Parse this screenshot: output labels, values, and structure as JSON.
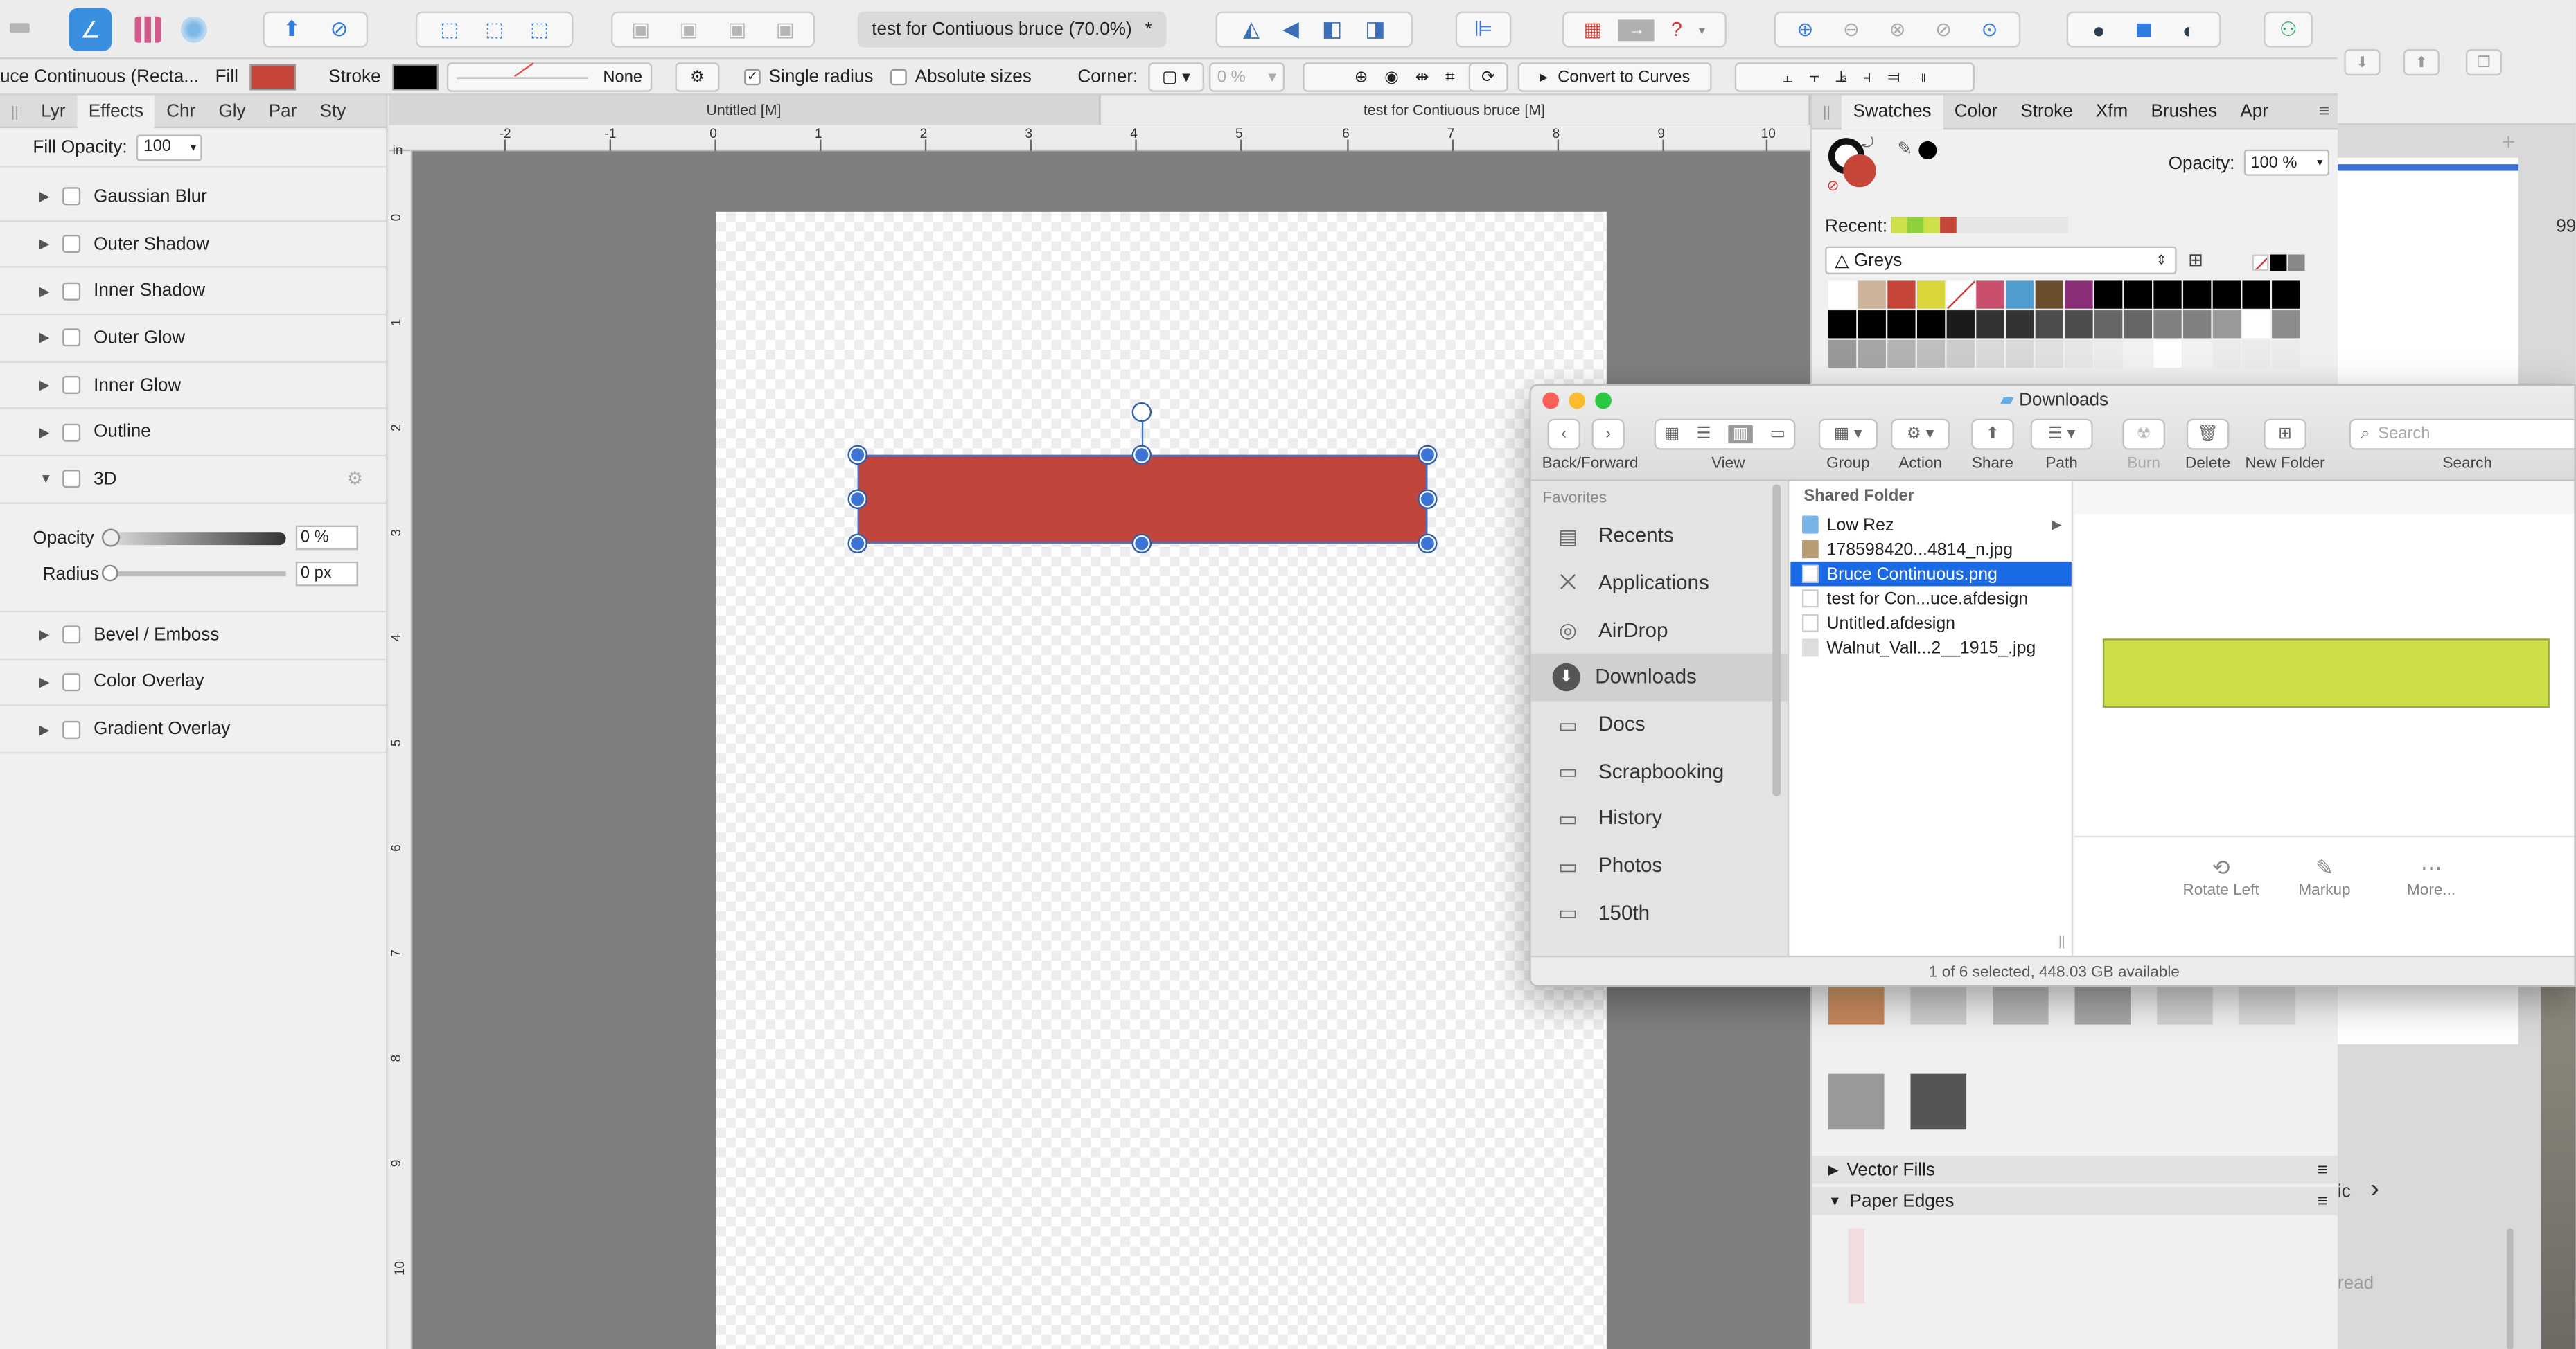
{
  "toolbar": {
    "doc_title": "test for Contiuous bruce (70.0%)",
    "modified_mark": "*",
    "tool_icons": [
      "persona-designer-icon",
      "persona-pixel-icon",
      "persona-export-icon",
      "share-icon",
      "forbidden-icon"
    ]
  },
  "contextbar": {
    "layer_name": "uce Continuous (Recta...",
    "fill_label": "Fill",
    "fill_color": "#C7463A",
    "stroke_label": "Stroke",
    "stroke_color": "#000000",
    "stroke_none": "None",
    "single_radius": "Single radius",
    "absolute_sizes": "Absolute sizes",
    "corner_label": "Corner:",
    "corner_value": "0 %",
    "convert_curves": "Convert to Curves"
  },
  "leftpanel": {
    "tabs": [
      "Lyr",
      "Effects",
      "Chr",
      "Gly",
      "Par",
      "Sty"
    ],
    "active_tab": "Effects",
    "fill_opacity_label": "Fill Opacity:",
    "fill_opacity_value": "100",
    "effects_before": [
      "Gaussian Blur",
      "Outer Shadow",
      "Inner Shadow",
      "Outer Glow",
      "Inner Glow",
      "Outline"
    ],
    "expanded_effect": "3D",
    "opacity_label": "Opacity",
    "opacity_value": "0 %",
    "radius_label": "Radius",
    "radius_value": "0 px",
    "effects_after": [
      "Bevel / Emboss",
      "Color Overlay",
      "Gradient Overlay"
    ]
  },
  "doc_tabs": [
    "Untitled [M]",
    "test for Contiuous bruce [M]"
  ],
  "ruler_top": [
    "-2",
    "-1",
    "0",
    "1",
    "2",
    "3",
    "4",
    "5",
    "6",
    "7",
    "8",
    "9",
    "10"
  ],
  "ruler_left": [
    "in",
    "0",
    "1",
    "2",
    "3",
    "4",
    "5",
    "6",
    "7",
    "8",
    "9",
    "10"
  ],
  "canvas": {
    "shape_color": "#C0453A"
  },
  "rightpanel": {
    "tabs": [
      "Swatches",
      "Color",
      "Stroke",
      "Xfm",
      "Brushes",
      "Apr"
    ],
    "active_tab": "Swatches",
    "opacity_label": "Opacity:",
    "opacity_value": "100 %",
    "recent_label": "Recent:",
    "recent_colors": [
      "#CDE04A",
      "#8FD13A",
      "#CDE04A",
      "#C7463A",
      "#E6E6E6"
    ],
    "palette_name": "Greys",
    "swatches": [
      "#ffffff",
      "#cdb39a",
      "#c7463a",
      "#d8d63a",
      "#ffffff",
      "#c94f6d",
      "#4f9ccf",
      "#6a4e2d",
      "#8a2e7a",
      "#000000",
      "#000000",
      "#000000",
      "#000000",
      "#000000",
      "#000000",
      "#000000",
      "#000000",
      "#000000",
      "#000000",
      "#000000",
      "#1a1a1a",
      "#333333",
      "#333333",
      "#4d4d4d",
      "#4d4d4d",
      "#666666",
      "#666666",
      "#808080",
      "#808080",
      "#999999",
      "#ffffff",
      "#8c8c8c",
      "#999999",
      "#a6a6a6",
      "#b3b3b3",
      "#bfbfbf",
      "#cccccc",
      "#d9d9d9",
      "#d9d9d9",
      "#e0e0e0",
      "#e6e6e6",
      "#ebebeb",
      "#f2f2f2",
      "#ffffff",
      "#f2f2f2",
      "#ebebeb",
      "#ebebeb",
      "#ebebeb"
    ],
    "vector_fills": "Vector Fills",
    "paper_edges": "Paper Edges"
  },
  "finder": {
    "title": "Downloads",
    "toolbar_labels": [
      "Back/Forward",
      "View",
      "Group",
      "Action",
      "Share",
      "Path",
      "Burn",
      "Delete",
      "New Folder",
      "Search"
    ],
    "search_placeholder": "Search",
    "favorites_label": "Favorites",
    "sidebar": [
      {
        "label": "Recents",
        "icon": "clock-icon"
      },
      {
        "label": "Applications",
        "icon": "applications-icon"
      },
      {
        "label": "AirDrop",
        "icon": "airdrop-icon"
      },
      {
        "label": "Downloads",
        "icon": "download-icon"
      },
      {
        "label": "Docs",
        "icon": "folder-icon"
      },
      {
        "label": "Scrapbooking",
        "icon": "folder-icon"
      },
      {
        "label": "History",
        "icon": "folder-icon"
      },
      {
        "label": "Photos",
        "icon": "folder-icon"
      },
      {
        "label": "150th",
        "icon": "folder-icon"
      }
    ],
    "selected_sidebar": "Downloads",
    "column_header": "Shared Folder",
    "files": [
      {
        "name": "Low Rez",
        "type": "folder"
      },
      {
        "name": "178598420...4814_n.jpg",
        "type": "image"
      },
      {
        "name": "Bruce Continuous.png",
        "type": "image"
      },
      {
        "name": "test for Con...uce.afdesign",
        "type": "doc"
      },
      {
        "name": "Untitled.afdesign",
        "type": "doc"
      },
      {
        "name": "Walnut_Vall...2__1915_.jpg",
        "type": "image"
      }
    ],
    "selected_file": "Bruce Continuous.png",
    "preview_color": "#CDDD48",
    "preview_actions": [
      "Rotate Left",
      "Markup",
      "More..."
    ],
    "status": "1 of 6 selected, 448.03 GB available"
  },
  "bgapp": {
    "fragments": [
      "99",
      "ic",
      "read"
    ]
  }
}
